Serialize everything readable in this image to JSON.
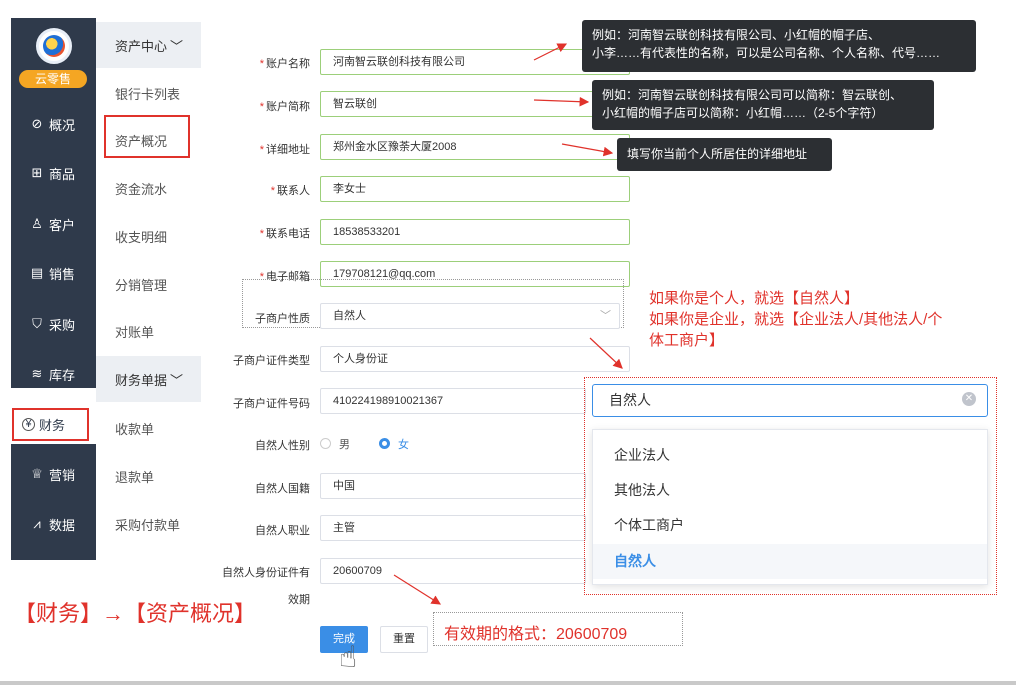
{
  "app": {
    "badge": "云零售"
  },
  "nav": {
    "items": [
      {
        "label": "概况",
        "icon": "compass-icon"
      },
      {
        "label": "商品",
        "icon": "grid-icon"
      },
      {
        "label": "客户",
        "icon": "user-icon"
      },
      {
        "label": "销售",
        "icon": "document-icon"
      },
      {
        "label": "采购",
        "icon": "basket-icon"
      },
      {
        "label": "库存",
        "icon": "layers-icon"
      },
      {
        "label": "财务",
        "icon": "yen-icon"
      },
      {
        "label": "营销",
        "icon": "crown-icon"
      },
      {
        "label": "数据",
        "icon": "chart-line-icon"
      }
    ]
  },
  "subnav": {
    "group1": "资产中心",
    "items1": [
      "银行卡列表",
      "资产概况",
      "资金流水",
      "收支明细",
      "分销管理",
      "对账单"
    ],
    "group2": "财务单据",
    "items2": [
      "收款单",
      "退款单",
      "采购付款单"
    ]
  },
  "form": {
    "account_name": {
      "label": "账户名称",
      "value": "河南智云联创科技有限公司"
    },
    "account_short": {
      "label": "账户简称",
      "value": "智云联创"
    },
    "address": {
      "label": "详细地址",
      "value": "郑州金水区豫荼大厦2008"
    },
    "contact": {
      "label": "联系人",
      "value": "李女士"
    },
    "phone": {
      "label": "联系电话",
      "value": "18538533201"
    },
    "email": {
      "label": "电子邮箱",
      "value": "179708121@qq.com"
    },
    "sub_type": {
      "label": "子商户性质",
      "value": "自然人"
    },
    "cert_type": {
      "label": "子商户证件类型",
      "value": "个人身份证"
    },
    "cert_no": {
      "label": "子商户证件号码",
      "value": "410224198910021367"
    },
    "gender": {
      "label": "自然人性别",
      "male": "男",
      "female": "女",
      "selected": "女"
    },
    "nationality": {
      "label": "自然人国籍",
      "value": "中国"
    },
    "occupation": {
      "label": "自然人职业",
      "value": "主管"
    },
    "id_expiry": {
      "label_line1": "自然人身份证件有",
      "label_line2": "效期",
      "value": "20600709"
    },
    "done": "完成",
    "reset": "重置"
  },
  "tips": {
    "tip1_line1": "例如：河南智云联创科技有限公司、小红帽的帽子店、",
    "tip1_line2": "小李……有代表性的名称，可以是公司名称、个人名称、代号……",
    "tip2_line1": "例如：河南智云联创科技有限公司可以简称：智云联创、",
    "tip2_line2": "小红帽的帽子店可以简称：小红帽……（2-5个字符）",
    "tip3": "填写你当前个人所居住的详细地址"
  },
  "notes": {
    "sub_type_line1": "如果你是个人，就选【自然人】",
    "sub_type_line2": "如果你是企业，就选【企业法人/其他法人/个",
    "sub_type_line3": "体工商户】",
    "expiry": "有效期的格式：20600709",
    "path": "【财务】→【资产概况】"
  },
  "dropdown": {
    "input": "自然人",
    "options": [
      "企业法人",
      "其他法人",
      "个体工商户",
      "自然人"
    ],
    "selected": "自然人"
  },
  "colors": {
    "accent": "#3a8ee6",
    "nav_bg": "#2f3a4b",
    "annotation": "#e0322b",
    "valid_border": "#9ccf7a"
  }
}
